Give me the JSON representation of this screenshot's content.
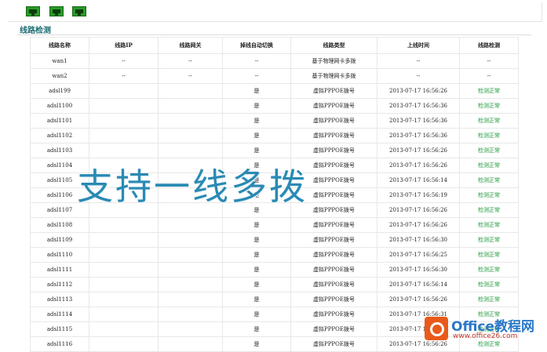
{
  "section_title": "线路检测",
  "table": {
    "headers": [
      "线路名称",
      "线路IP",
      "线路网关",
      "掉线自动切换",
      "线路类型",
      "上线时间",
      "线路检测"
    ],
    "rows": [
      [
        "wan1",
        "--",
        "--",
        "--",
        "基于物理网卡多拨",
        "--",
        "--"
      ],
      [
        "wan2",
        "--",
        "--",
        "--",
        "基于物理网卡多拨",
        "--",
        "--"
      ],
      [
        "adsl199",
        "",
        "",
        "是",
        "虚拟PPPOE拨号",
        "2013-07-17 16:56:26",
        "检测正常"
      ],
      [
        "adsl1100",
        "",
        "",
        "是",
        "虚拟PPPOE拨号",
        "2013-07-17 16:56:36",
        "检测正常"
      ],
      [
        "adsl1101",
        "",
        "",
        "是",
        "虚拟PPPOE拨号",
        "2013-07-17 16:56:36",
        "检测正常"
      ],
      [
        "adsl1102",
        "",
        "",
        "是",
        "虚拟PPPOE拨号",
        "2013-07-17 16:56:36",
        "检测正常"
      ],
      [
        "adsl1103",
        "",
        "",
        "是",
        "虚拟PPPOE拨号",
        "2013-07-17 16:56:26",
        "检测正常"
      ],
      [
        "adsl1104",
        "",
        "",
        "是",
        "虚拟PPPOE拨号",
        "2013-07-17 16:56:26",
        "检测正常"
      ],
      [
        "adsl1105",
        "",
        "",
        "是",
        "虚拟PPPOE拨号",
        "2013-07-17 16:56:14",
        "检测正常"
      ],
      [
        "adsl1106",
        "",
        "",
        "是",
        "虚拟PPPOE拨号",
        "2013-07-17 16:56:19",
        "检测正常"
      ],
      [
        "adsl1107",
        "",
        "",
        "是",
        "虚拟PPPOE拨号",
        "2013-07-17 16:56:26",
        "检测正常"
      ],
      [
        "adsl1108",
        "",
        "",
        "是",
        "虚拟PPPOE拨号",
        "2013-07-17 16:56:26",
        "检测正常"
      ],
      [
        "adsl1109",
        "",
        "",
        "是",
        "虚拟PPPOE拨号",
        "2013-07-17 16:56:30",
        "检测正常"
      ],
      [
        "adsl1110",
        "",
        "",
        "是",
        "虚拟PPPOE拨号",
        "2013-07-17 16:56:25",
        "检测正常"
      ],
      [
        "adsl1111",
        "",
        "",
        "是",
        "虚拟PPPOE拨号",
        "2013-07-17 16:56:30",
        "检测正常"
      ],
      [
        "adsl1112",
        "",
        "",
        "是",
        "虚拟PPPOE拨号",
        "2013-07-17 16:56:14",
        "检测正常"
      ],
      [
        "adsl1113",
        "",
        "",
        "是",
        "虚拟PPPOE拨号",
        "2013-07-17 16:56:26",
        "检测正常"
      ],
      [
        "adsl1114",
        "",
        "",
        "是",
        "虚拟PPPOE拨号",
        "2013-07-17 16:56:31",
        "检测正常"
      ],
      [
        "adsl1115",
        "",
        "",
        "是",
        "虚拟PPPOE拨号",
        "2013-07-17 16:56:30",
        "检测正常"
      ],
      [
        "adsl1116",
        "",
        "",
        "是",
        "虚拟PPPOE拨号",
        "2013-07-17 16:56:26",
        "检测正常"
      ]
    ]
  },
  "watermark_text": "支持一线多拨",
  "site_logo": {
    "name": "Office教程网",
    "url": "www.office26.com",
    "brand_color": "#2a78c8",
    "icon_color": "#e95a1a"
  },
  "status_colors": {
    "ok": "#1e9a3a"
  },
  "icons": [
    "network-port-icon",
    "network-port-icon",
    "network-port-icon"
  ]
}
